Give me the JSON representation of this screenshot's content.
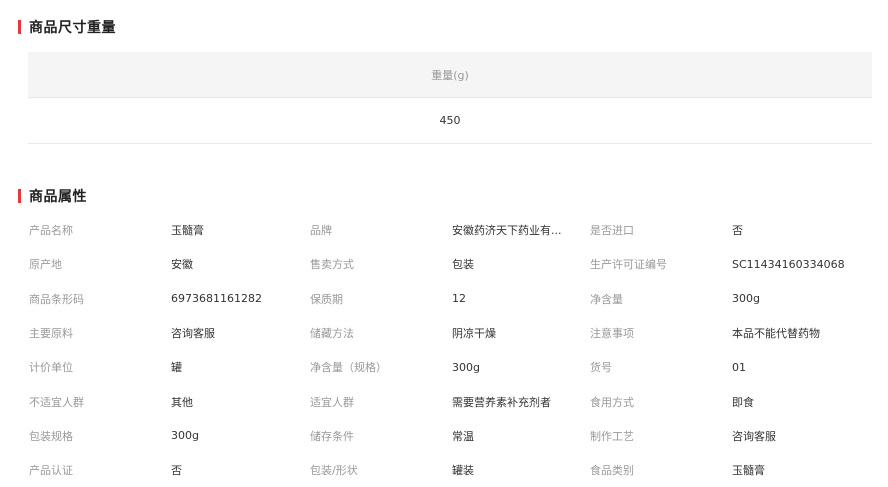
{
  "dimensions_section": {
    "title": "商品尺寸重量",
    "header": "重量(g)",
    "value": "450"
  },
  "attributes_section": {
    "title": "商品属性",
    "rows": [
      [
        {
          "label": "产品名称",
          "value": "玉髓膏"
        },
        {
          "label": "品牌",
          "value": "安徽药济天下药业有..."
        },
        {
          "label": "是否进口",
          "value": "否"
        }
      ],
      [
        {
          "label": "原产地",
          "value": "安徽"
        },
        {
          "label": "售卖方式",
          "value": "包装"
        },
        {
          "label": "生产许可证编号",
          "value": "SC11434160334068"
        }
      ],
      [
        {
          "label": "商品条形码",
          "value": "6973681161282"
        },
        {
          "label": "保质期",
          "value": "12"
        },
        {
          "label": "净含量",
          "value": "300g"
        }
      ],
      [
        {
          "label": "主要原料",
          "value": "咨询客服"
        },
        {
          "label": "储藏方法",
          "value": "阴凉干燥"
        },
        {
          "label": "注意事项",
          "value": "本品不能代替药物"
        }
      ],
      [
        {
          "label": "计价单位",
          "value": "罐"
        },
        {
          "label": "净含量（规格）",
          "value": "300g"
        },
        {
          "label": "货号",
          "value": "01"
        }
      ],
      [
        {
          "label": "不适宜人群",
          "value": "其他"
        },
        {
          "label": "适宜人群",
          "value": "需要营养素补充剂者"
        },
        {
          "label": "食用方式",
          "value": "即食"
        }
      ],
      [
        {
          "label": "包装规格",
          "value": "300g"
        },
        {
          "label": "储存条件",
          "value": "常温"
        },
        {
          "label": "制作工艺",
          "value": "咨询客服"
        }
      ],
      [
        {
          "label": "产品认证",
          "value": "否"
        },
        {
          "label": "包装/形状",
          "value": "罐装"
        },
        {
          "label": "食品类别",
          "value": "玉髓膏"
        }
      ]
    ]
  },
  "accent_color": "#e4393c"
}
